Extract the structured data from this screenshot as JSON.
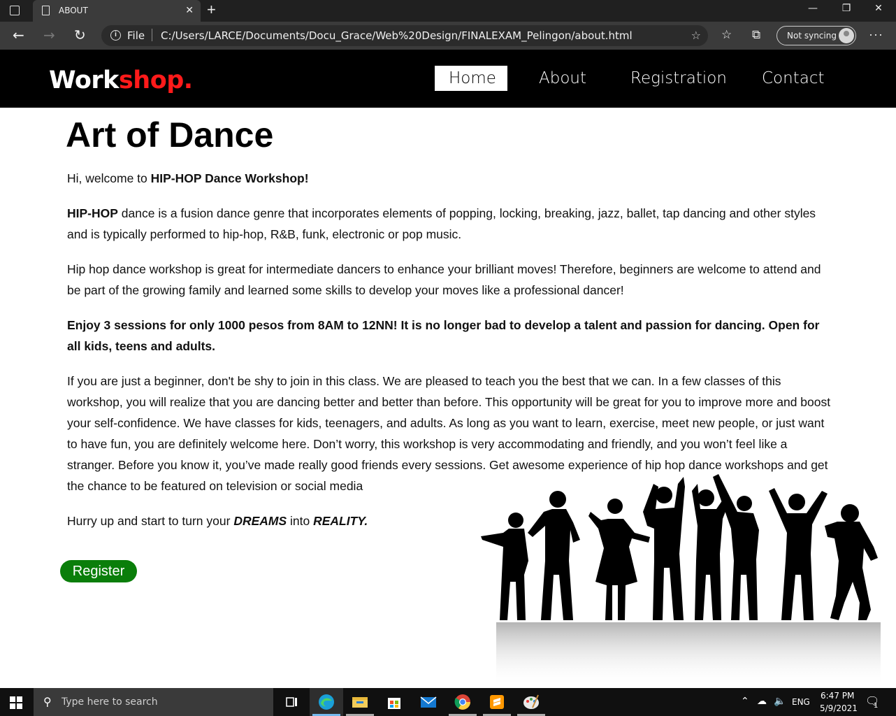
{
  "browser": {
    "tab_title": "ABOUT",
    "tab_close": "✕",
    "new_tab": "+",
    "window_minimize": "—",
    "window_restore": "❐",
    "window_close": "✕",
    "back": "←",
    "forward": "→",
    "refresh": "↻",
    "url_scheme": "File",
    "url": "C:/Users/LARCE/Documents/Docu_Grace/Web%20Design/FINALEXAM_Pelingon/about.html",
    "sync_label": "Not syncing",
    "more": "···"
  },
  "site": {
    "logo_part1": "Work",
    "logo_part2": "shop.",
    "nav": [
      {
        "label": "Home"
      },
      {
        "label": "About"
      },
      {
        "label": "Registration"
      },
      {
        "label": "Contact"
      }
    ]
  },
  "content": {
    "title": "Art of Dance",
    "welcome_prefix": "Hi, welcome to ",
    "welcome_bold": "HIP-HOP Dance Workshop!",
    "p1_bold": "HIP-HOP",
    "p1_rest": " dance is a fusion dance genre that incorporates elements of popping, locking, breaking, jazz, ballet, tap dancing and other styles and is typically performed to hip-hop, R&B, funk, electronic or pop music.",
    "p2": "Hip hop dance workshop is great for intermediate dancers to enhance your brilliant moves! Therefore, beginners are welcome to attend and be part of the growing family and learned some skills to develop your moves like a professional dancer!",
    "p3": "Enjoy 3 sessions for only 1000 pesos from 8AM to 12NN! It is no longer bad to develop a talent and passion for dancing. Open for all kids, teens and adults.",
    "p4": "If you are just a beginner, don't be shy to join in this class. We are pleased to teach you the best that we can. In a few classes of this workshop, you will realize that you are dancing better and better than before. This opportunity will be great for you to improve more and boost your self-confidence. We have classes for kids, teenagers, and adults. As long as you want to learn, exercise, meet new people, or just want to have fun, you are definitely welcome here. Don’t worry, this workshop is very accommodating and friendly, and you won’t feel like a stranger. Before you know it, you’ve made really good friends every sessions. Get awesome experience of hip hop dance workshops and get the chance to be featured on television or social media",
    "p5_prefix": "Hurry up and start to turn your ",
    "p5_dreams": "DREAMS",
    "p5_mid": " into ",
    "p5_reality": "REALITY.",
    "register_label": "Register"
  },
  "taskbar": {
    "search_placeholder": "Type here to search",
    "language": "ENG",
    "time": "6:47 PM",
    "date": "5/9/2021",
    "notification_count": "1"
  },
  "colors": {
    "brand_red": "#ff1a1a",
    "register_green": "#0a7e0a",
    "header_black": "#000000"
  }
}
